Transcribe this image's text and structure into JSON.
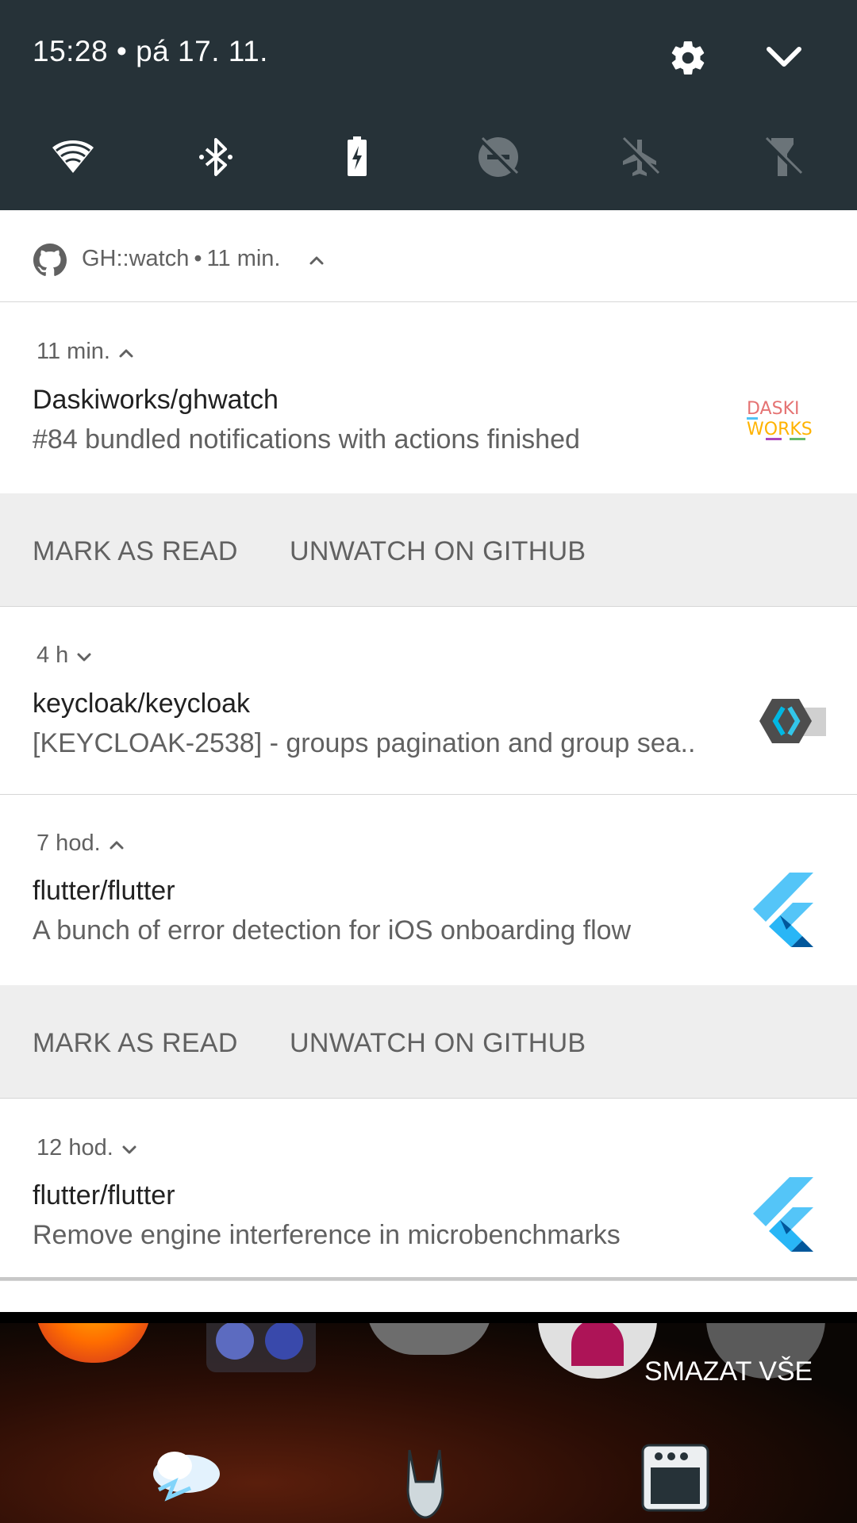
{
  "status": {
    "time_date": "15:28 • pá 17. 11."
  },
  "quick_tiles": [
    {
      "name": "wifi-icon"
    },
    {
      "name": "bluetooth-icon"
    },
    {
      "name": "battery-saver-icon"
    },
    {
      "name": "do-not-disturb-icon"
    },
    {
      "name": "airplane-mode-icon"
    },
    {
      "name": "flashlight-icon"
    }
  ],
  "group": {
    "app_name": "GH::watch",
    "time": "11 min."
  },
  "notifications": [
    {
      "time": "11 min.",
      "title": "Daskiworks/ghwatch",
      "body": "#84 bundled notifications with actions finished",
      "expanded": true,
      "thumb": "daskiworks-logo"
    },
    {
      "time": "4 h",
      "title": "keycloak/keycloak",
      "body": "[KEYCLOAK-2538] - groups pagination and group sea..",
      "expanded": false,
      "thumb": "keycloak-logo"
    },
    {
      "time": "7 hod.",
      "title": "flutter/flutter",
      "body": "A bunch of error detection for iOS onboarding flow",
      "expanded": true,
      "thumb": "flutter-logo"
    },
    {
      "time": "12 hod.",
      "title": "flutter/flutter",
      "body": "Remove engine interference in microbenchmarks",
      "expanded": false,
      "thumb": "flutter-logo"
    }
  ],
  "actions": {
    "mark_as_read": "MARK AS READ",
    "unwatch": "UNWATCH ON GITHUB"
  },
  "logo_text": {
    "daskiworks_top": "DASKI",
    "daskiworks_bottom": "WORKS"
  },
  "clear_all": "SMAZAT VŠE",
  "colors": {
    "header_bg": "#263238",
    "action_bar_bg": "#eeeeee",
    "flutter_light": "#54c5f8",
    "flutter_dark": "#01579b"
  }
}
